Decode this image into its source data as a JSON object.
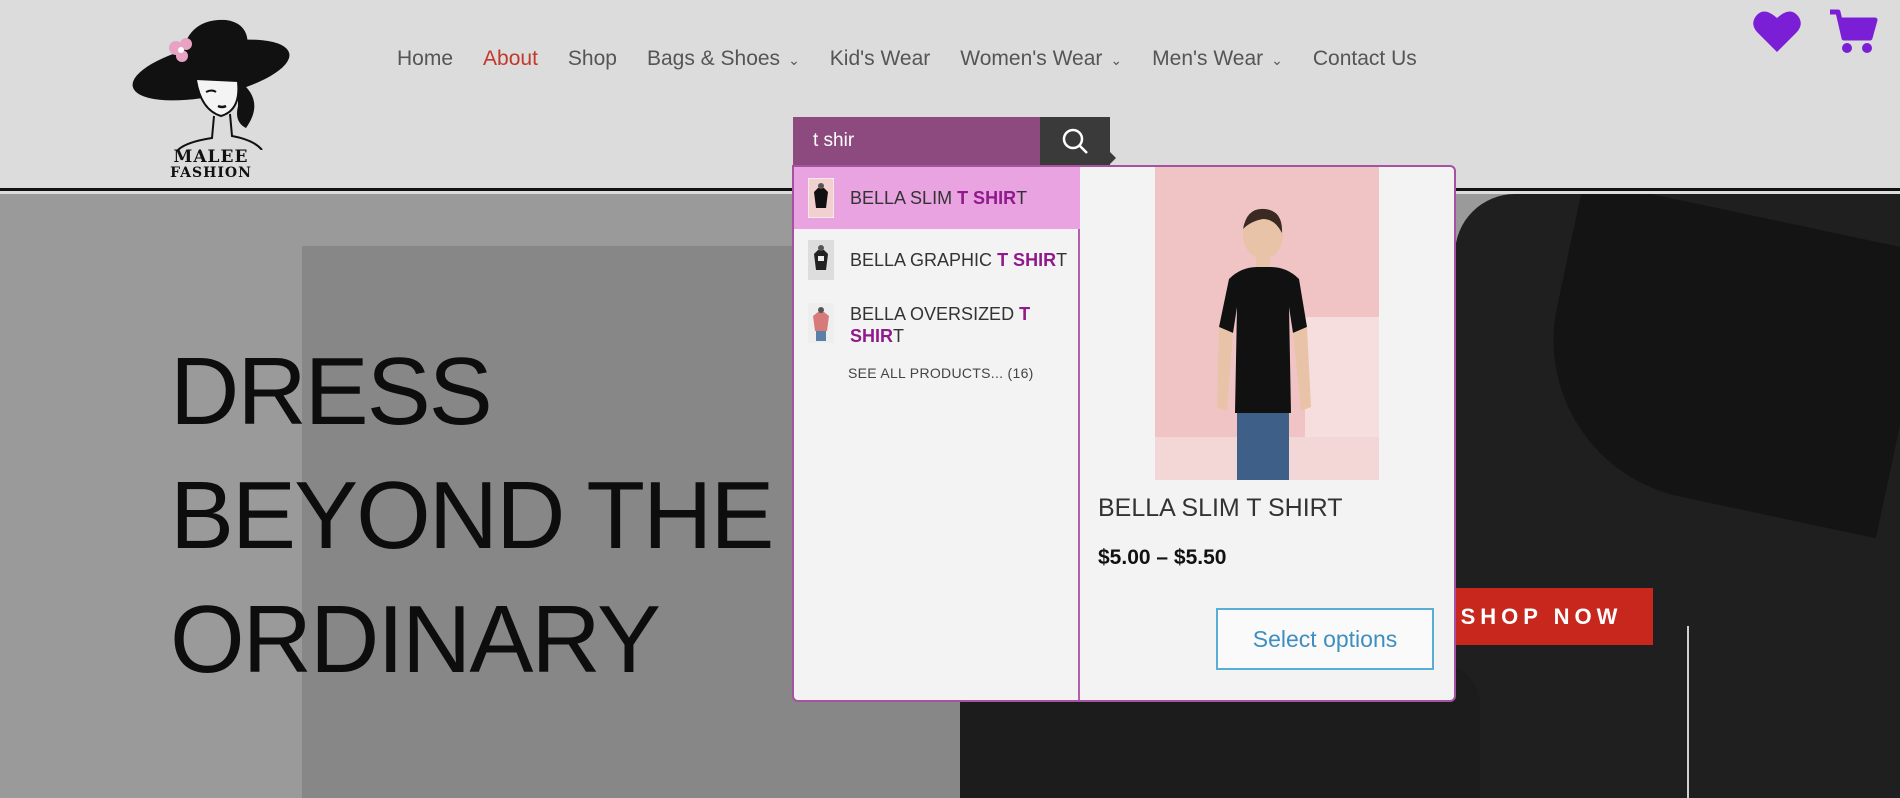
{
  "brand": {
    "line1": "MALEE",
    "line2": "FASHION"
  },
  "nav": {
    "items": [
      {
        "label": "Home",
        "active": false,
        "dropdown": false
      },
      {
        "label": "About",
        "active": true,
        "dropdown": false
      },
      {
        "label": "Shop",
        "active": false,
        "dropdown": false
      },
      {
        "label": "Bags & Shoes",
        "active": false,
        "dropdown": true
      },
      {
        "label": "Kid's Wear",
        "active": false,
        "dropdown": false
      },
      {
        "label": "Women's Wear",
        "active": false,
        "dropdown": true
      },
      {
        "label": "Men's Wear",
        "active": false,
        "dropdown": true
      },
      {
        "label": "Contact Us",
        "active": false,
        "dropdown": false
      }
    ]
  },
  "header_icons": {
    "wishlist": "heart-icon",
    "cart": "cart-icon",
    "color": "#7a1fd6"
  },
  "hero": {
    "title_lines": [
      "DRESS",
      "BEYOND THE",
      "ORDINARY"
    ],
    "cta": "SHOP NOW"
  },
  "search": {
    "value": "t shir",
    "results": [
      {
        "prefix": "BELLA SLIM ",
        "match": "T SHIR",
        "suffix": "T",
        "selected": true
      },
      {
        "prefix": "BELLA GRAPHIC ",
        "match": "T SHIR",
        "suffix": "T",
        "selected": false
      },
      {
        "prefix": "BELLA OVERSIZED ",
        "match": "T SHIR",
        "suffix": "T",
        "selected": false
      }
    ],
    "see_all": "SEE ALL PRODUCTS... (16)",
    "preview": {
      "title": "BELLA SLIM T SHIRT",
      "price": "$5.00 – $5.50",
      "button": "Select options"
    }
  },
  "colors": {
    "accent": "#c8271e",
    "search_bg": "#8d4a7e",
    "highlight": "#8e1a8b",
    "selected_bg": "#e8a3e0"
  }
}
